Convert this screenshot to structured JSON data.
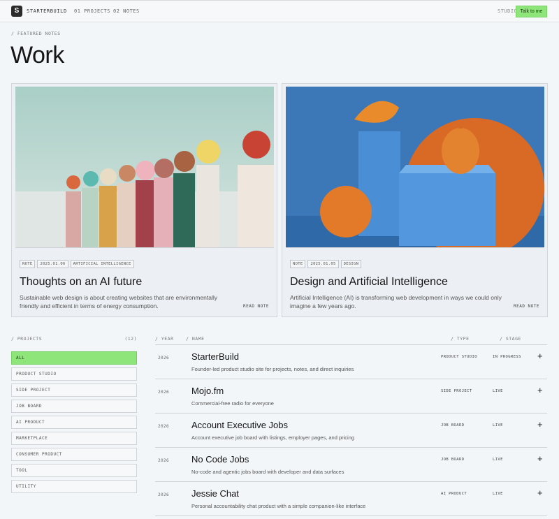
{
  "nav": {
    "brand": "STARTERBUILD",
    "logo_letter": "S",
    "projects_link": "01 PROJECTS",
    "notes_link": "02 NOTES",
    "studio_label": "STUDIO",
    "cta": "Talk to me"
  },
  "breadcrumb": "/ FEATURED NOTES",
  "title": "Work",
  "cards": [
    {
      "tags": [
        "NOTE",
        "2025.01.06",
        "ARTIFICIAL INTELLIGENCE"
      ],
      "title": "Thoughts on an AI future",
      "desc": "Sustainable web design is about creating websites that are environmentally friendly and efficient in terms of energy consumption.",
      "cta": "READ NOTE"
    },
    {
      "tags": [
        "NOTE",
        "2025.01.05",
        "DESIGN"
      ],
      "title": "Design and Artificial Intelligence",
      "desc": "Artificial Intelligence (AI) is transforming web development in ways we could only imagine a few years ago.",
      "cta": "READ NOTE"
    }
  ],
  "projects": {
    "heading": "/ PROJECTS",
    "count": "(12)",
    "filters": [
      "ALL",
      "PRODUCT STUDIO",
      "SIDE PROJECT",
      "JOB BOARD",
      "AI PRODUCT",
      "MARKETPLACE",
      "CONSUMER PRODUCT",
      "TOOL",
      "UTILITY"
    ],
    "active_filter": "ALL"
  },
  "table": {
    "headers": {
      "year": "/ YEAR",
      "name": "/ NAME",
      "type": "/ TYPE",
      "stage": "/ STAGE"
    },
    "rows": [
      {
        "year": "2026",
        "name": "StarterBuild",
        "desc": "Founder-led product studio site for projects, notes, and direct inquiries",
        "type": "PRODUCT STUDIO",
        "stage": "IN PROGRESS"
      },
      {
        "year": "2026",
        "name": "Mojo.fm",
        "desc": "Commercial-free radio for everyone",
        "type": "SIDE PROJECT",
        "stage": "LIVE"
      },
      {
        "year": "2026",
        "name": "Account Executive Jobs",
        "desc": "Account executive job board with listings, employer pages, and pricing",
        "type": "JOB BOARD",
        "stage": "LIVE"
      },
      {
        "year": "2026",
        "name": "No Code Jobs",
        "desc": "No-code and agentic jobs board with developer and data surfaces",
        "type": "JOB BOARD",
        "stage": "LIVE"
      },
      {
        "year": "2026",
        "name": "Jessie Chat",
        "desc": "Personal accountability chat product with a simple companion-like interface",
        "type": "AI PRODUCT",
        "stage": "LIVE"
      }
    ]
  },
  "colors": {
    "accent": "#8ee57a",
    "background": "#f3f6f9"
  },
  "icons": {
    "expand": "plus-icon",
    "logo": "logo-icon"
  }
}
